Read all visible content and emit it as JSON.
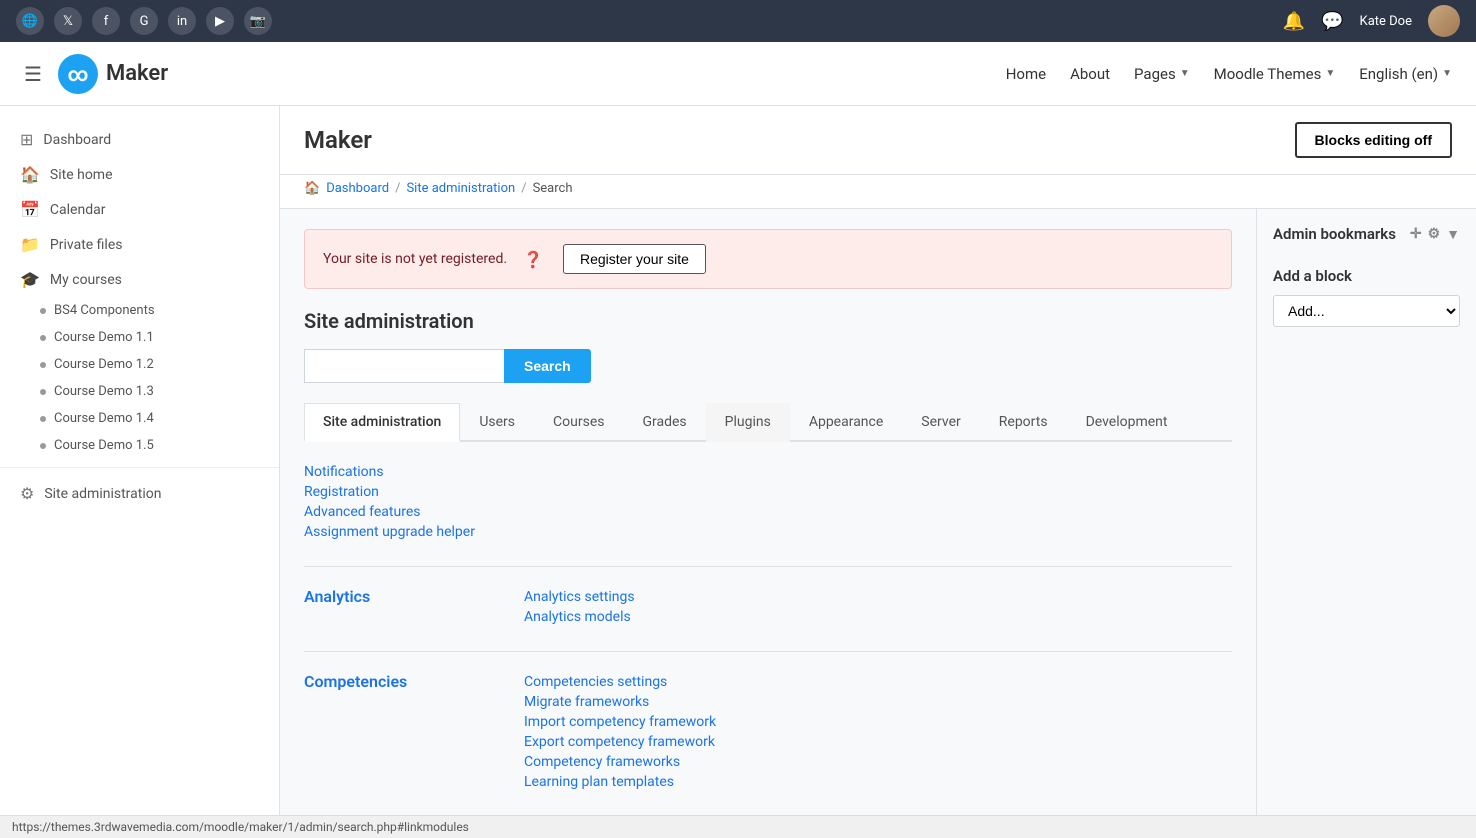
{
  "social_bar": {
    "icons": [
      "globe",
      "twitter",
      "facebook",
      "google-plus",
      "linkedin",
      "youtube",
      "instagram"
    ]
  },
  "top_nav": {
    "logo_text": "Maker",
    "nav_items": [
      {
        "label": "Home",
        "dropdown": false
      },
      {
        "label": "About",
        "dropdown": false
      },
      {
        "label": "Pages",
        "dropdown": true
      },
      {
        "label": "Moodle Themes",
        "dropdown": true
      },
      {
        "label": "English (en)",
        "dropdown": true
      }
    ],
    "user_name": "Kate Doe",
    "notification_icon": "bell",
    "message_icon": "comment"
  },
  "sidebar": {
    "items": [
      {
        "label": "Dashboard",
        "icon": "grid"
      },
      {
        "label": "Site home",
        "icon": "home"
      },
      {
        "label": "Calendar",
        "icon": "calendar"
      },
      {
        "label": "Private files",
        "icon": "file"
      },
      {
        "label": "My courses",
        "icon": "graduation-cap"
      }
    ],
    "my_courses_sub": [
      {
        "label": "BS4 Components"
      },
      {
        "label": "Course Demo 1.1"
      },
      {
        "label": "Course Demo 1.2"
      },
      {
        "label": "Course Demo 1.3"
      },
      {
        "label": "Course Demo 1.4"
      },
      {
        "label": "Course Demo 1.5"
      }
    ],
    "bottom_items": [
      {
        "label": "Site administration",
        "icon": "cog"
      }
    ]
  },
  "header": {
    "title": "Maker",
    "blocks_editing_btn": "Blocks editing off"
  },
  "breadcrumb": {
    "items": [
      "Dashboard",
      "Site administration",
      "Search"
    ]
  },
  "alert": {
    "text": "Your site is not yet registered.",
    "button": "Register your site"
  },
  "site_admin": {
    "heading": "Site administration",
    "search_placeholder": "",
    "search_btn": "Search"
  },
  "tabs": [
    {
      "label": "Site administration",
      "active": true
    },
    {
      "label": "Users",
      "active": false
    },
    {
      "label": "Courses",
      "active": false
    },
    {
      "label": "Grades",
      "active": false
    },
    {
      "label": "Plugins",
      "active": false,
      "hovered": true
    },
    {
      "label": "Appearance",
      "active": false
    },
    {
      "label": "Server",
      "active": false
    },
    {
      "label": "Reports",
      "active": false
    },
    {
      "label": "Development",
      "active": false
    }
  ],
  "site_admin_links": [
    {
      "label": "Notifications"
    },
    {
      "label": "Registration"
    },
    {
      "label": "Advanced features"
    },
    {
      "label": "Assignment upgrade helper"
    }
  ],
  "analytics": {
    "title": "Analytics",
    "links": [
      {
        "label": "Analytics settings"
      },
      {
        "label": "Analytics models"
      }
    ]
  },
  "competencies": {
    "title": "Competencies",
    "links": [
      {
        "label": "Competencies settings"
      },
      {
        "label": "Migrate frameworks"
      },
      {
        "label": "Import competency framework"
      },
      {
        "label": "Export competency framework"
      },
      {
        "label": "Competency frameworks"
      },
      {
        "label": "Learning plan templates"
      }
    ]
  },
  "right_panel": {
    "admin_bookmarks_title": "Admin bookmarks",
    "add_block_title": "Add a block",
    "add_block_placeholder": "Add...",
    "add_block_options": [
      "Add..."
    ]
  },
  "status_bar": {
    "url": "https://themes.3rdwavemedia.com/moodle/maker/1/admin/search.php#linkmodules"
  }
}
